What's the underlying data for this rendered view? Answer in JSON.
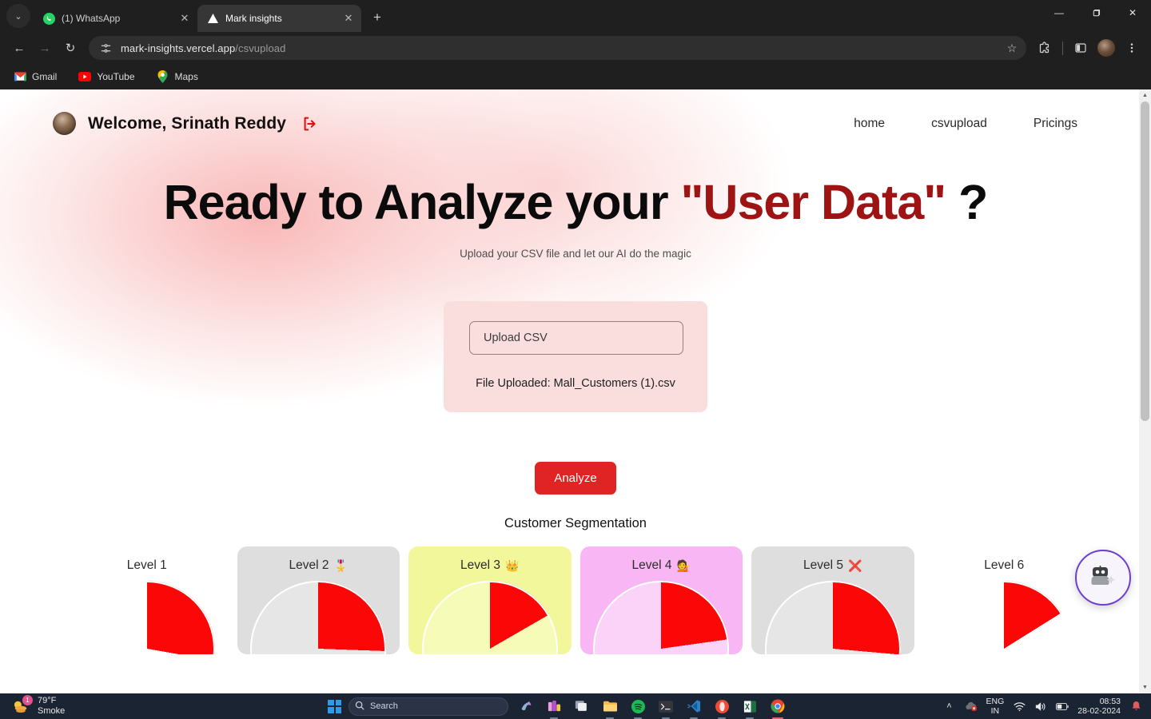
{
  "browser": {
    "tabs": [
      {
        "title": "(1) WhatsApp",
        "favicon": "whatsapp-icon",
        "active": false
      },
      {
        "title": "Mark insights",
        "favicon": "vercel-triangle-icon",
        "active": true
      }
    ],
    "newtab_label": "+",
    "tablist_label": "⌄",
    "window_controls": {
      "minimize": "—",
      "maximize": "❐",
      "close": "✕"
    },
    "nav": {
      "back": "←",
      "forward": "→",
      "reload": "↻"
    },
    "omnibox": {
      "site_info_icon": "page-settings-icon",
      "url_host": "mark-insights.vercel.app",
      "url_path": "/csvupload",
      "bookmark_star": "☆"
    },
    "toolbar_icons": [
      {
        "name": "extensions-icon",
        "glyph": "⬚"
      },
      {
        "name": "side-panel-icon",
        "glyph": "◧"
      },
      {
        "name": "profile-avatar",
        "glyph": ""
      },
      {
        "name": "chrome-menu-icon",
        "glyph": "⋮"
      }
    ],
    "bookmarks": [
      {
        "label": "Gmail",
        "icon": "gmail-icon"
      },
      {
        "label": "YouTube",
        "icon": "youtube-icon"
      },
      {
        "label": "Maps",
        "icon": "maps-icon"
      }
    ]
  },
  "site": {
    "header": {
      "welcome_text": "Welcome, Srinath Reddy",
      "avatar": "user-avatar",
      "logout_icon": "logout-icon",
      "nav": [
        {
          "label": "home"
        },
        {
          "label": "csvupload"
        },
        {
          "label": "Pricings"
        }
      ]
    },
    "hero": {
      "title_part1": "Ready to Analyze your ",
      "title_accent": "\"User Data\"",
      "title_part2": " ?",
      "subtitle": "Upload your CSV file and let our AI do the magic"
    },
    "upload": {
      "field_label": "Upload CSV",
      "status": "File Uploaded: Mall_Customers (1).csv"
    },
    "analyze_button": "Analyze",
    "segmentation_title": "Customer Segmentation",
    "ai_fab_icon": "ai-robot-icon",
    "colors": {
      "accent_red": "#e02424",
      "slice_red": "#fb0707",
      "hero_accent": "#9e1414",
      "upload_card_bg": "#fadedd",
      "fab_border": "#6d3fd1"
    }
  },
  "chart_data": {
    "type": "pie",
    "title": "Customer Segmentation",
    "charts": [
      {
        "label": "Level 1",
        "emoji": "",
        "card_bg": "#ffffff",
        "slice_deg": 100,
        "slice_pct": 28,
        "rest_color": "#ffffff"
      },
      {
        "label": "Level 2",
        "emoji": "🎖️",
        "card_bg": "#dedede",
        "slice_deg": 92,
        "slice_pct": 26,
        "rest_color": "#e6e6e6"
      },
      {
        "label": "Level 3",
        "emoji": "👑",
        "card_bg": "#f3f79c",
        "slice_deg": 60,
        "slice_pct": 17,
        "rest_color": "#f7fbb8"
      },
      {
        "label": "Level 4",
        "emoji": "💁",
        "card_bg": "#f9b6f4",
        "slice_deg": 82,
        "slice_pct": 23,
        "rest_color": "#fbd2f8"
      },
      {
        "label": "Level 5",
        "emoji": "❌",
        "card_bg": "#dedede",
        "slice_deg": 95,
        "slice_pct": 26,
        "rest_color": "#e6e6e6"
      },
      {
        "label": "Level 6",
        "emoji": "",
        "card_bg": "#ffffff",
        "slice_deg": 58,
        "slice_pct": 16,
        "rest_color": "#ffffff"
      }
    ],
    "legend_position": "none",
    "grid": false
  },
  "taskbar": {
    "weather": {
      "temp": "79°F",
      "condition": "Smoke",
      "badge": "1",
      "icon": "weather-smoke-icon"
    },
    "start_icon": "windows-start-icon",
    "search_placeholder": "Search",
    "search_icon": "search-icon",
    "apps": [
      {
        "name": "copilot-icon",
        "glyph": "✨"
      },
      {
        "name": "powerbi-icon",
        "glyph": "📊"
      },
      {
        "name": "task-view-icon",
        "glyph": "❐"
      },
      {
        "name": "file-explorer-icon",
        "glyph": "📁"
      },
      {
        "name": "spotify-icon",
        "glyph": "●"
      },
      {
        "name": "terminal-icon",
        "glyph": "⌫"
      },
      {
        "name": "vscode-icon",
        "glyph": "⬧"
      },
      {
        "name": "opera-icon",
        "glyph": "●"
      },
      {
        "name": "excel-icon",
        "glyph": "X"
      },
      {
        "name": "chrome-icon",
        "glyph": "◉"
      }
    ],
    "tray": {
      "chevron": "˄",
      "onedrive_icon": "onedrive-error-icon",
      "language_line1": "ENG",
      "language_line2": "IN",
      "wifi_icon": "wifi-icon",
      "volume_icon": "volume-icon",
      "battery_icon": "battery-icon",
      "time": "08:53",
      "date": "28-02-2024",
      "notification_icon": "bell-icon"
    }
  }
}
